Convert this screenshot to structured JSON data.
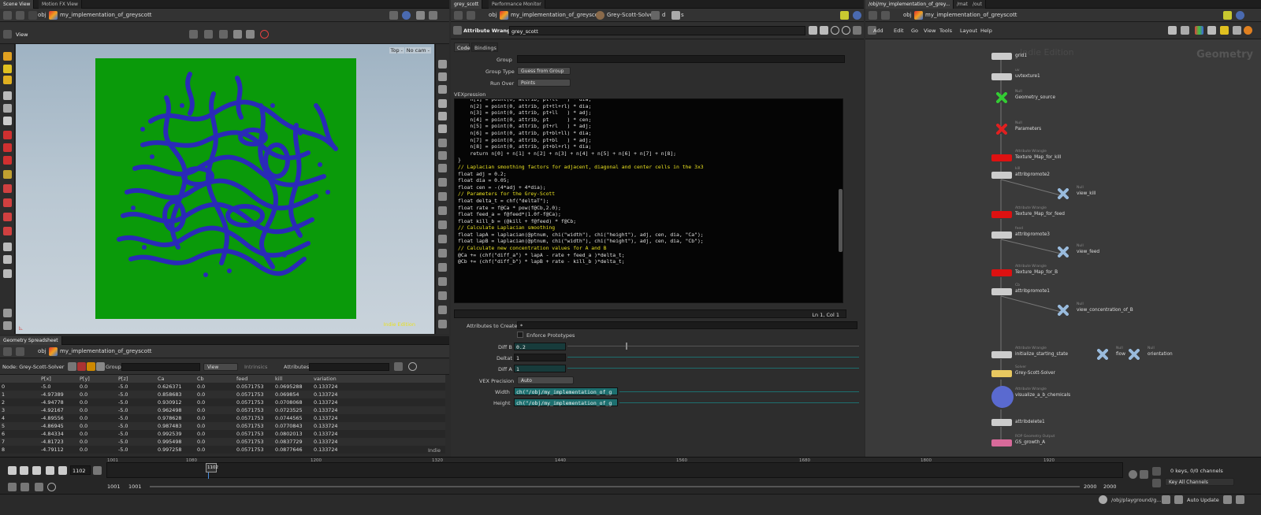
{
  "left_panel": {
    "tabs": [
      "Scene View",
      "Motion FX View",
      "Geometry Spreadsheet"
    ],
    "path": "my_implementation_of_greyscott",
    "obj_label": "obj",
    "view_label": "View",
    "persp_label": "Top -",
    "cam_label": "No cam -",
    "indie_label": "Indie Edition"
  },
  "spreadsheet": {
    "node_label": "Node: Grey-Scott-Solver",
    "group_label": "Group:",
    "view_label": "View",
    "intrinsics_label": "Intrinsics",
    "attributes_label": "Attributes:",
    "columns": [
      "",
      "P[x]",
      "P[y]",
      "P[z]",
      "Ca",
      "Cb",
      "feed",
      "kill",
      "variation"
    ],
    "rows": [
      [
        "0",
        "-5.0",
        "0.0",
        "-5.0",
        "0.626371",
        "0.0",
        "0.0571753",
        "0.0695288",
        "0.133724"
      ],
      [
        "1",
        "-4.97389",
        "0.0",
        "-5.0",
        "0.858683",
        "0.0",
        "0.0571753",
        "0.069854",
        "0.133724"
      ],
      [
        "2",
        "-4.94778",
        "0.0",
        "-5.0",
        "0.930912",
        "0.0",
        "0.0571753",
        "0.0708068",
        "0.133724"
      ],
      [
        "3",
        "-4.92167",
        "0.0",
        "-5.0",
        "0.962498",
        "0.0",
        "0.0571753",
        "0.0723525",
        "0.133724"
      ],
      [
        "4",
        "-4.89556",
        "0.0",
        "-5.0",
        "0.978628",
        "0.0",
        "0.0571753",
        "0.0744565",
        "0.133724"
      ],
      [
        "5",
        "-4.86945",
        "0.0",
        "-5.0",
        "0.987483",
        "0.0",
        "0.0571753",
        "0.0770843",
        "0.133724"
      ],
      [
        "6",
        "-4.84334",
        "0.0",
        "-5.0",
        "0.992539",
        "0.0",
        "0.0571753",
        "0.0802013",
        "0.133724"
      ],
      [
        "7",
        "-4.81723",
        "0.0",
        "-5.0",
        "0.995498",
        "0.0",
        "0.0571753",
        "0.0837729",
        "0.133724"
      ],
      [
        "8",
        "-4.79112",
        "0.0",
        "-5.0",
        "0.997258",
        "0.0",
        "0.0571753",
        "0.0877646",
        "0.133724"
      ]
    ],
    "indie": "Indie"
  },
  "middle_panel": {
    "tabs": [
      "grey_scott",
      "Performance Monitor"
    ],
    "path": "my_implementation_of_greyscott",
    "solver_label": "Grey-Scott-Solver",
    "d_label": "d",
    "s_label": "s",
    "node_type": "Attribute Wrangle",
    "node_name": "grey_scott",
    "subtabs": [
      "Code",
      "Bindings"
    ],
    "group_label": "Group",
    "group_type_label": "Group Type",
    "group_type_value": "Guess from Group",
    "run_over_label": "Run Over",
    "run_over_value": "Points",
    "vexpression_label": "VEXpression",
    "code_lines": [
      "    n[1] = point(0, attrib, pt+tl   ) * dia;",
      "    n[2] = point(0, attrib, pt+tl+rl) * dia;",
      "    n[3] = point(0, attrib, pt+ll   ) * adj;",
      "    n[4] = point(0, attrib, pt      ) * cen;",
      "    n[5] = point(0, attrib, pt+rl   ) * adj;",
      "    n[6] = point(0, attrib, pt+bl+ll) * dia;",
      "    n[7] = point(0, attrib, pt+bl   ) * adj;",
      "    n[8] = point(0, attrib, pt+bl+rl) * dia;",
      "",
      "    return n[0] + n[1] + n[2] + n[3] + n[4] + n[5] + n[6] + n[7] + n[8];",
      "}",
      "",
      "// Laplacian smoothing factors for adjacent, diagonal and center cells in the 3x3",
      "float adj = 0.2;",
      "float dia = 0.05;",
      "float cen = -(4*adj + 4*dia);",
      "",
      "// Parameters for the Grey-Scott",
      "float delta_t = chf(\"deltaT\");",
      "float rate = f@Ca * pow(f@Cb,2.0);",
      "float feed_a = f@feed*(1.0f-f@Ca);",
      "float kill_b = (@kill + f@feed) * f@Cb;",
      "",
      "// Calculate Laplacian smoothing",
      "float lapA = laplacian(@ptnum, chi(\"width\"), chi(\"height\"), adj, cen, dia, \"Ca\");",
      "float lapB = laplacian(@ptnum, chi(\"width\"), chi(\"height\"), adj, cen, dia, \"Cb\");",
      "",
      "// Calculate new concentration values for A and B",
      "@Ca += (chf(\"diff_a\") * lapA - rate + feed_a )*delta_t;",
      "@Cb += (chf(\"diff_b\") * lapB + rate - kill_b )*delta_t;"
    ],
    "cursor_pos": "Ln 1, Col 1",
    "attributes_to_create_label": "Attributes to Create",
    "attributes_to_create_value": "*",
    "enforce_prototypes_label": "Enforce Prototypes",
    "params": [
      {
        "label": "Diff B",
        "value": "0.2"
      },
      {
        "label": "Deltat",
        "value": "1"
      },
      {
        "label": "Diff A",
        "value": "1"
      }
    ],
    "vex_precision_label": "VEX Precision",
    "vex_precision_value": "Auto",
    "width_label": "Width",
    "width_value": "ch(\"/obj/my_implementation_of_g",
    "height_label": "Height",
    "height_value": "ch(\"/obj/my_implementation_of_g"
  },
  "right_panel": {
    "tabs": [
      "/obj/my_implementation_of_grey...",
      "/mat",
      "/out"
    ],
    "path": "my_implementation_of_greyscott",
    "menu": [
      "Add",
      "Edit",
      "Go",
      "View",
      "Tools",
      "Layout",
      "Help"
    ],
    "indie_watermark": "Indie Edition",
    "geometry_watermark": "Geometry",
    "nodes": [
      {
        "name": "grid1",
        "sub": "",
        "color": "#cccccc"
      },
      {
        "name": "uvtexture1",
        "sub": "uv",
        "color": "#cccccc"
      },
      {
        "name": "Geometry_source",
        "sub": "Null",
        "color": "#33cc33"
      },
      {
        "name": "Parameters",
        "sub": "Null",
        "color": "#e02020"
      },
      {
        "name": "Texture_Map_for_kill",
        "sub": "Attribute Wrangle",
        "color": "#dd1111"
      },
      {
        "name": "attribpromote2",
        "sub": "kill",
        "color": "#cccccc"
      },
      {
        "name": "view_kill",
        "sub": "Null",
        "color": "#99bbdd"
      },
      {
        "name": "Texture_Map_for_feed",
        "sub": "Attribute Wrangle",
        "color": "#dd1111"
      },
      {
        "name": "attribpromote3",
        "sub": "feed",
        "color": "#cccccc"
      },
      {
        "name": "view_feed",
        "sub": "Null",
        "color": "#99bbdd"
      },
      {
        "name": "Texture_Map_for_B",
        "sub": "Attribute Wrangle",
        "color": "#dd1111"
      },
      {
        "name": "attribpromote1",
        "sub": "Cb",
        "color": "#cccccc"
      },
      {
        "name": "view_concentration_of_B",
        "sub": "Null",
        "color": "#99bbdd"
      },
      {
        "name": "initialize_starting_state",
        "sub": "Attribute Wrangle",
        "color": "#cccccc"
      },
      {
        "name": "flow",
        "sub": "Null",
        "color": "#99bbdd"
      },
      {
        "name": "orientation",
        "sub": "Null",
        "color": "#99bbdd"
      },
      {
        "name": "Grey-Scott-Solver",
        "sub": "Solver",
        "color": "#e8c860"
      },
      {
        "name": "visualize_a_b_chemicals",
        "sub": "Attribute Wrangle",
        "color": "#5a6ad0"
      },
      {
        "name": "attribdelete1",
        "sub": "",
        "color": "#cccccc"
      },
      {
        "name": "GS_growth_A",
        "sub": "ROP Geometry Output",
        "color": "#d86a9a"
      }
    ]
  },
  "timeline": {
    "current_frame": "1102",
    "marker": "1102",
    "ticks": [
      "1001",
      "1080",
      "1200",
      "1320",
      "1440",
      "1560",
      "1680",
      "1800",
      "1920"
    ],
    "start1": "1001",
    "start2": "1001",
    "end1": "2000",
    "end2": "2000",
    "keys_info": "0 keys, 0/0 channels",
    "key_all": "Key All Channels",
    "path_status": "/obj/playground/g...",
    "auto_update": "Auto Update"
  },
  "colors": {
    "viewport_green": "#0a9a0a",
    "pattern_blue": "#2a2ab8",
    "code_bg": "#050505",
    "comment_yellow": "#e8e020",
    "keyword_blue": "#4aa0ff",
    "string_green": "#8bd36b",
    "param_teal": "#1d6f6f"
  }
}
